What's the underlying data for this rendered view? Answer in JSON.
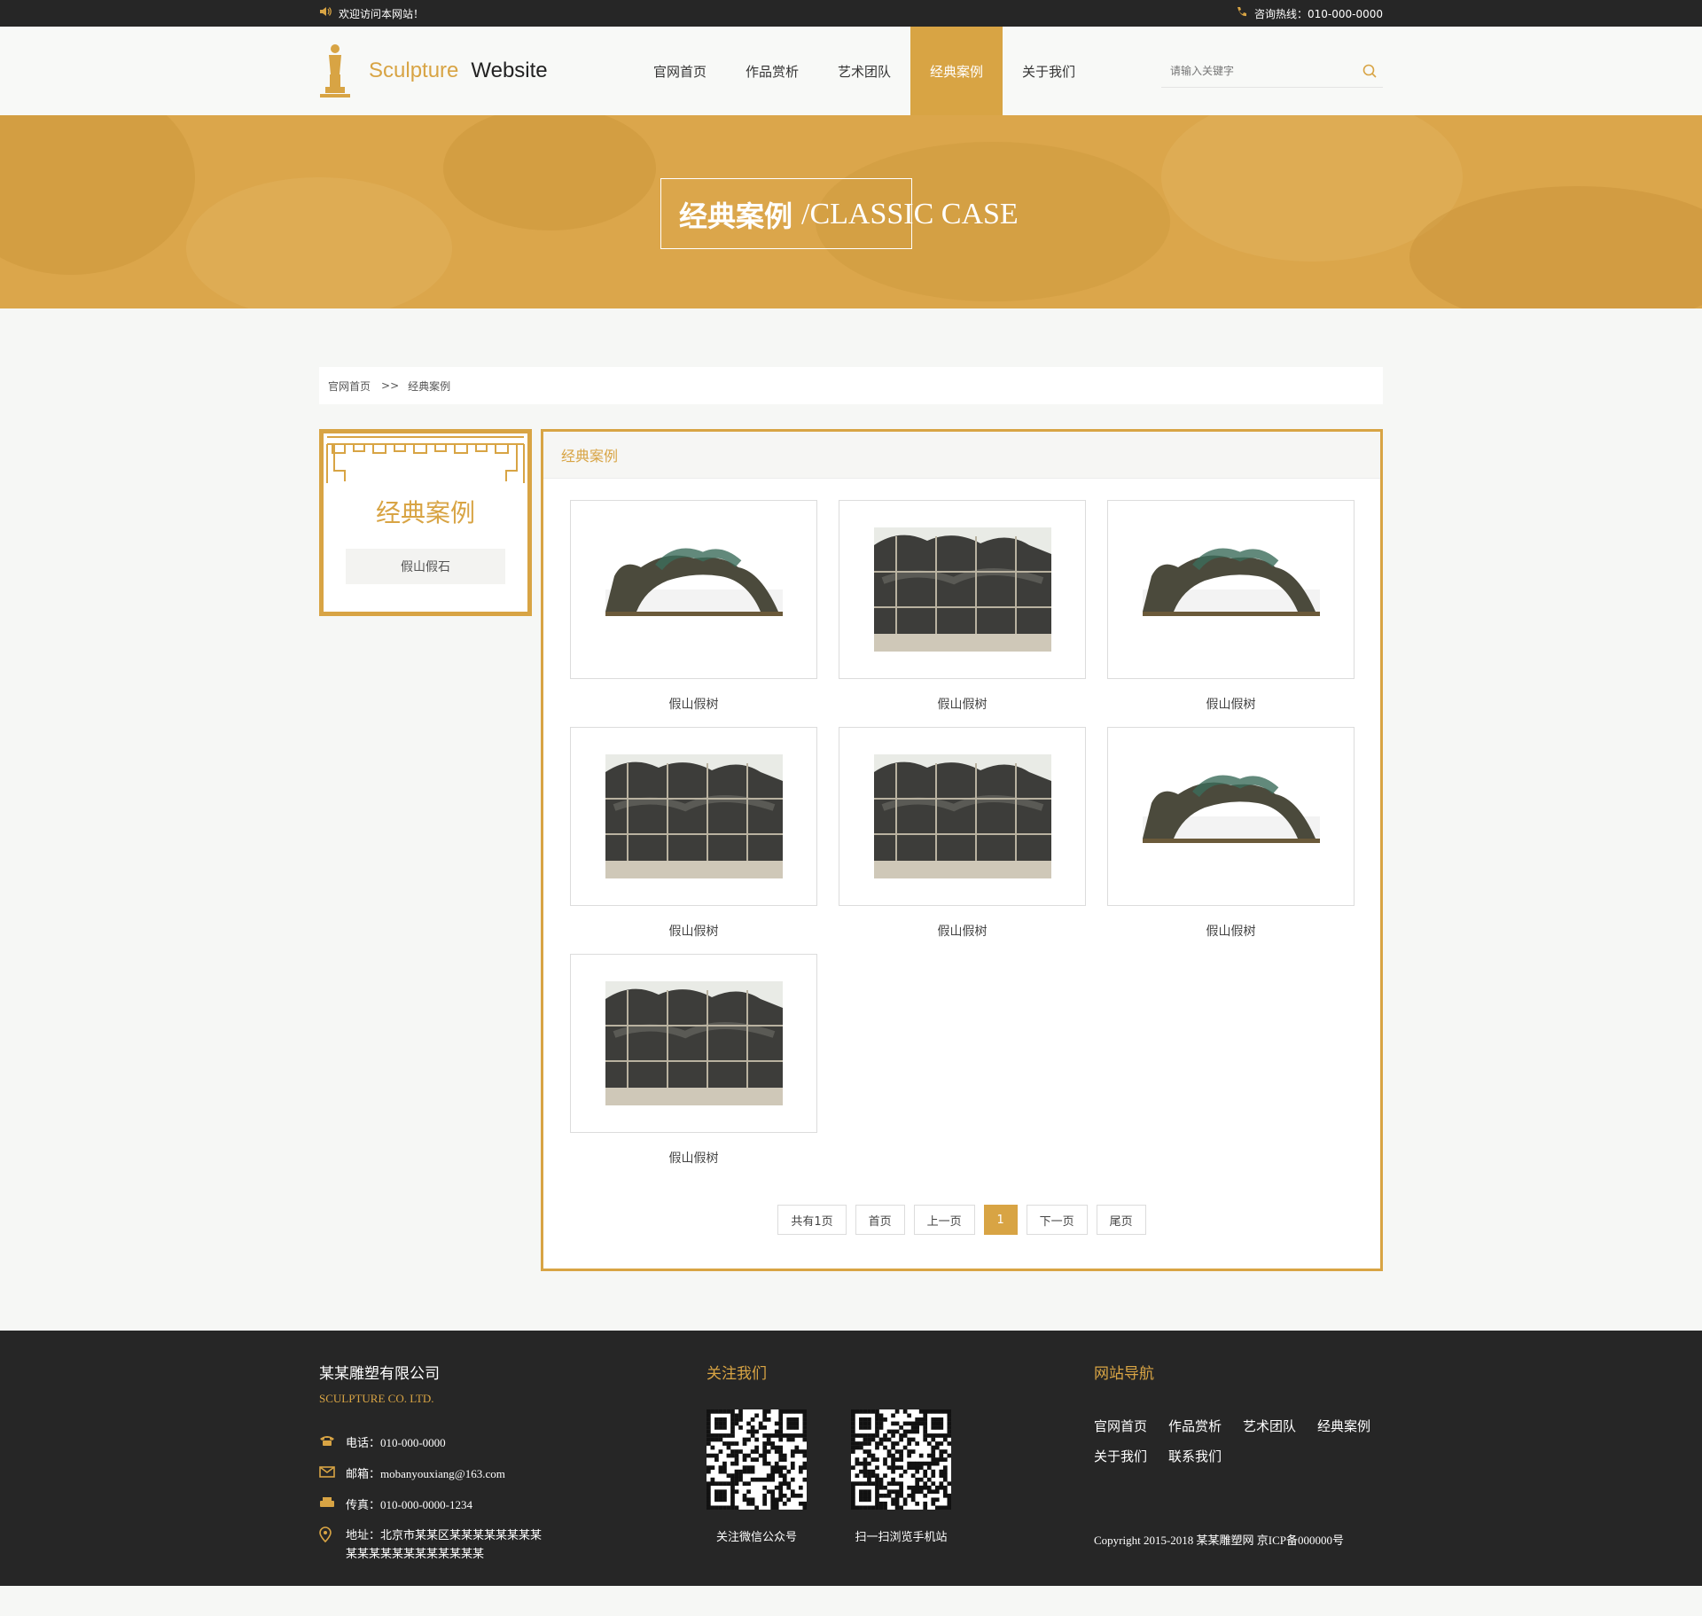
{
  "topbar": {
    "welcome": "欢迎访问本网站！",
    "hotline": "咨询热线：010-000-0000"
  },
  "logo": {
    "word1": "Sculpture",
    "word2": "Website"
  },
  "nav": {
    "items": [
      {
        "label": "官网首页",
        "active": false
      },
      {
        "label": "作品赏析",
        "active": false
      },
      {
        "label": "艺术团队",
        "active": false
      },
      {
        "label": "经典案例",
        "active": true
      },
      {
        "label": "关于我们",
        "active": false
      }
    ]
  },
  "search": {
    "placeholder": "请输入关键字"
  },
  "banner": {
    "title_cn": "经典案例",
    "title_en": "/CLASSIC CASE"
  },
  "breadcrumb": {
    "home": "官网首页",
    "sep": ">>",
    "current": "经典案例"
  },
  "sidebar": {
    "title": "经典案例",
    "item": "假山假石"
  },
  "content": {
    "heading": "经典案例",
    "cards": [
      {
        "caption": "假山假树",
        "image": "tree-arch"
      },
      {
        "caption": "假山假树",
        "image": "rock-wall"
      },
      {
        "caption": "假山假树",
        "image": "tree-arch"
      },
      {
        "caption": "假山假树",
        "image": "rock-wall"
      },
      {
        "caption": "假山假树",
        "image": "rock-wall"
      },
      {
        "caption": "假山假树",
        "image": "tree-arch"
      },
      {
        "caption": "假山假树",
        "image": "rock-wall"
      }
    ]
  },
  "pager": {
    "total": "共有1页",
    "first": "首页",
    "prev": "上一页",
    "current": "1",
    "next": "下一页",
    "last": "尾页"
  },
  "footer": {
    "company": "某某雕塑有限公司",
    "company_en": "SCULPTURE CO. LTD.",
    "phone_label": "电话：",
    "phone": "010-000-0000",
    "email_label": "邮箱：",
    "email": "mobanyouxiang@163.com",
    "fax_label": "传真：",
    "fax": "010-000-0000-1234",
    "address_label": "地址：",
    "address_line1": "北京市某某区某某某某某某某某",
    "address_line2": "某某某某某某某某某某某某",
    "follow_title": "关注我们",
    "qr1_caption": "关注微信公众号",
    "qr2_caption": "扫一扫浏览手机站",
    "nav_title": "网站导航",
    "nav_links": [
      "官网首页",
      "作品赏析",
      "艺术团队",
      "经典案例",
      "关于我们",
      "联系我们"
    ],
    "copyright": "Copyright 2015-2018 某某雕塑网 京ICP备000000号"
  },
  "colors": {
    "accent": "#d8a444",
    "dark": "#262626"
  }
}
